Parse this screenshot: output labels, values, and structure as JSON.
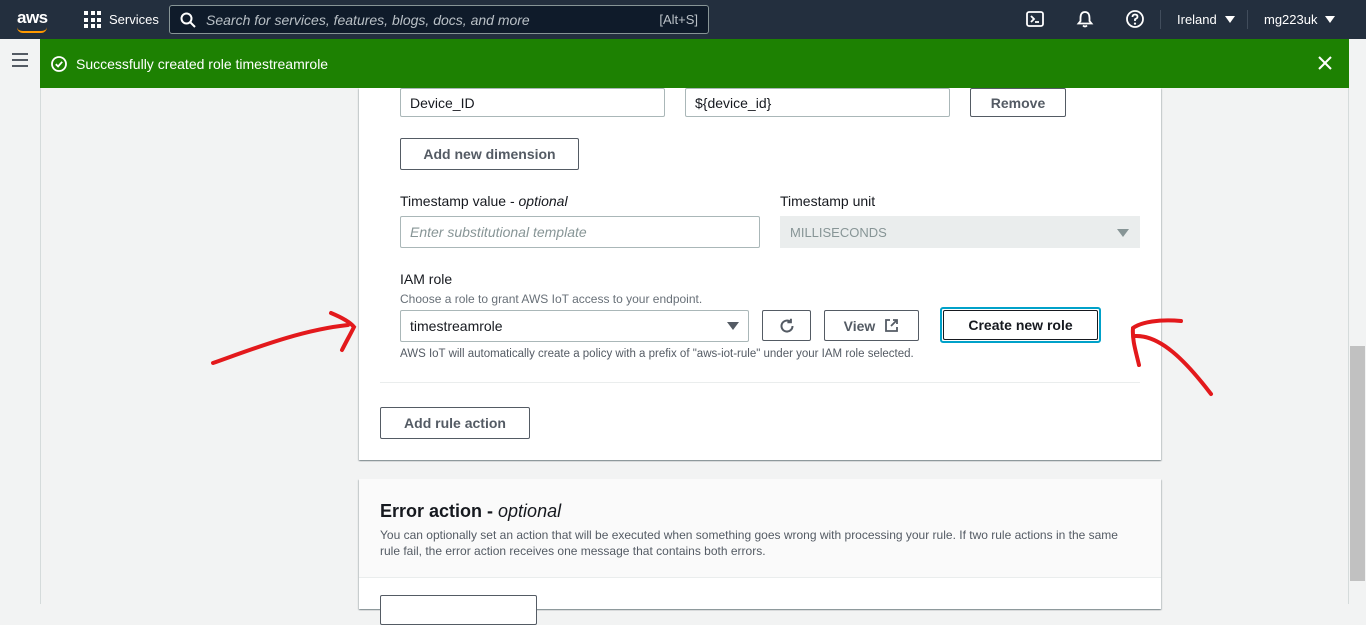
{
  "topnav": {
    "logo": "aws",
    "services_label": "Services",
    "search_placeholder": "Search for services, features, blogs, docs, and more",
    "search_shortcut": "[Alt+S]",
    "region": "Ireland",
    "account": "mg223uk"
  },
  "flash": {
    "message": "Successfully created role timestreamrole",
    "type": "success",
    "color": "#1d8102"
  },
  "dimension": {
    "name_value": "Device_ID",
    "value_value": "${device_id}",
    "remove_label": "Remove",
    "add_label": "Add new dimension"
  },
  "timestamp": {
    "value_label": "Timestamp value - ",
    "value_optional": "optional",
    "value_placeholder": "Enter substitutional template",
    "unit_label": "Timestamp unit",
    "unit_value": "MILLISECONDS"
  },
  "iam": {
    "label": "IAM role",
    "description": "Choose a role to grant AWS IoT access to your endpoint.",
    "selected_role": "timestreamrole",
    "view_label": "View",
    "create_label": "Create new role",
    "note": "AWS IoT will automatically create a policy with a prefix of \"aws-iot-rule\" under your IAM role selected."
  },
  "add_rule_action_label": "Add rule action",
  "error_action": {
    "title": "Error action - ",
    "title_optional": "optional",
    "description": "You can optionally set an action that will be executed when something goes wrong with processing your rule. If two rule actions in the same rule fail, the error action receives one message that contains both errors."
  },
  "colors": {
    "nav_bg": "#232f3e",
    "accent": "#ff9900",
    "annotation": "#e3191c",
    "focus": "#00a1c9"
  }
}
